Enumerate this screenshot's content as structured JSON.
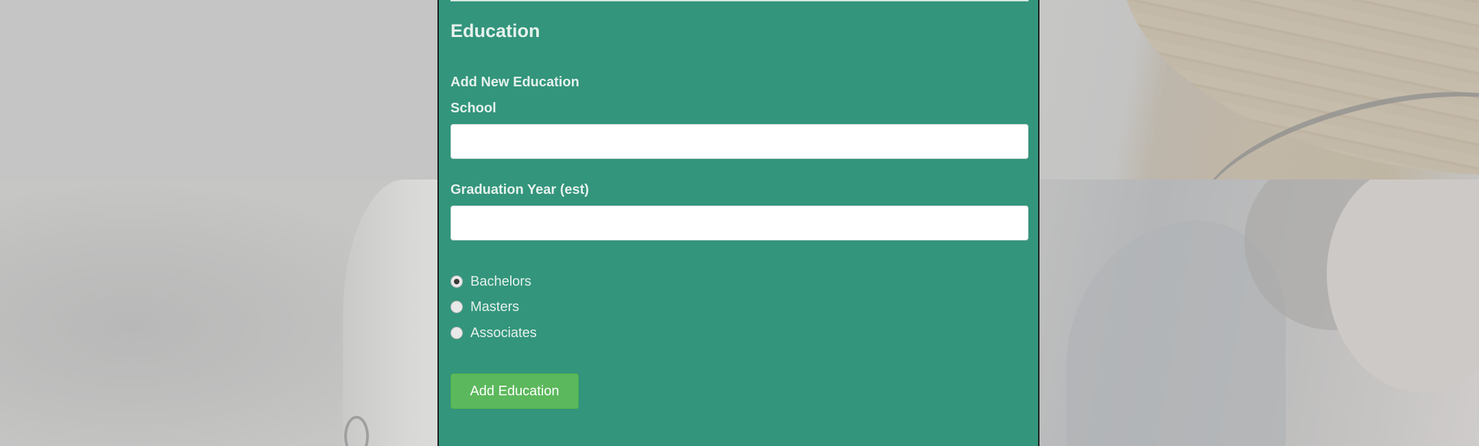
{
  "education": {
    "section_title": "Education",
    "add_new_title": "Add New Education",
    "school": {
      "label": "School",
      "value": ""
    },
    "graduation_year": {
      "label": "Graduation Year (est)",
      "value": ""
    },
    "degree_options": [
      {
        "label": "Bachelors",
        "checked": true
      },
      {
        "label": "Masters",
        "checked": false
      },
      {
        "label": "Associates",
        "checked": false
      }
    ],
    "submit_label": "Add Education"
  },
  "colors": {
    "panel_background": "#32957c",
    "button_background": "#5cb85c",
    "page_background": "#c4c6c5"
  }
}
